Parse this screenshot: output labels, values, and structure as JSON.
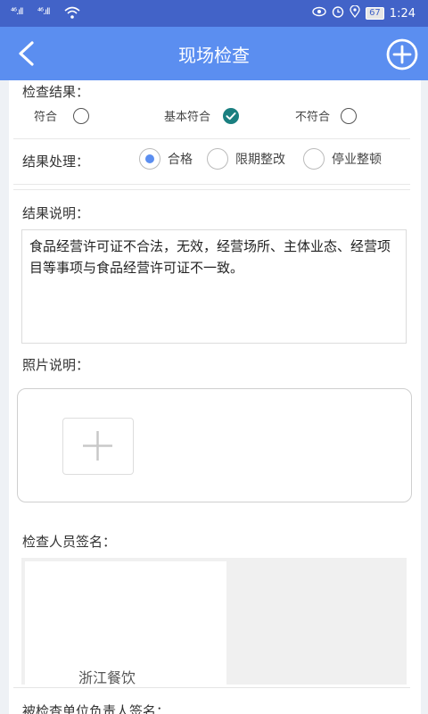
{
  "status_bar": {
    "signal_1": "⁴⁶.ıll",
    "signal_2": "⁴⁶.ıll",
    "battery": "67",
    "time": "1:24"
  },
  "header": {
    "title": "现场检查"
  },
  "form": {
    "result_label": "检查结果：",
    "result_options": [
      "符合",
      "基本符合",
      "不符合"
    ],
    "result_selected": "基本符合",
    "handling_label": "结果处理：",
    "handling_options": [
      "合格",
      "限期整改",
      "停业整顿"
    ],
    "handling_selected": "合格",
    "explanation_label": "结果说明：",
    "explanation_text": "食品经营许可证不合法，无效，经营场所、主体业态、经营项目等事项与食品经营许可证不一致。",
    "photo_label": "照片说明：",
    "inspector_sign_label": "检查人员签名：",
    "inspector_signature": "浙江餐饮",
    "unit_sign_label": "被检查单位负责人签名："
  },
  "colors": {
    "status_bar": "#4263c8",
    "header": "#5b8ef0",
    "check": "#1a7f80",
    "radio_on": "#5b8ef0"
  }
}
